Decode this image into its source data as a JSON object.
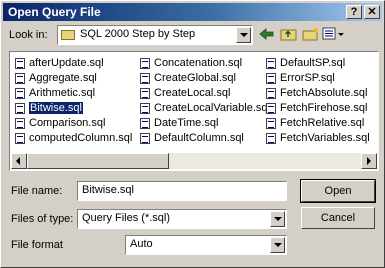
{
  "window": {
    "title": "Open Query File",
    "help_label": "?",
    "close_label": "✕"
  },
  "lookin": {
    "label": "Look in:",
    "value": "SQL 2000 Step by Step"
  },
  "toolbar": {
    "back_icon": "back-arrow-icon",
    "up_icon": "up-folder-icon",
    "new_folder_icon": "new-folder-icon",
    "views_icon": "views-menu-icon"
  },
  "files": {
    "col1": [
      "afterUpdate.sql",
      "Aggregate.sql",
      "Arithmetic.sql",
      "Bitwise.sql",
      "Comparison.sql",
      "computedColumn.sql"
    ],
    "col2": [
      "Concatenation.sql",
      "CreateGlobal.sql",
      "CreateLocal.sql",
      "CreateLocalVariable.sql",
      "DateTime.sql",
      "DefaultColumn.sql"
    ],
    "col3": [
      "DefaultSP.sql",
      "ErrorSP.sql",
      "FetchAbsolute.sql",
      "FetchFirehose.sql",
      "FetchRelative.sql",
      "FetchVariables.sql"
    ],
    "selected": "Bitwise.sql"
  },
  "filename": {
    "label": "File name:",
    "value": "Bitwise.sql"
  },
  "filetype": {
    "label": "Files of type:",
    "value": "Query Files (*.sql)"
  },
  "fileformat": {
    "label": "File format",
    "value": "Auto"
  },
  "buttons": {
    "open": "Open",
    "cancel": "Cancel"
  }
}
